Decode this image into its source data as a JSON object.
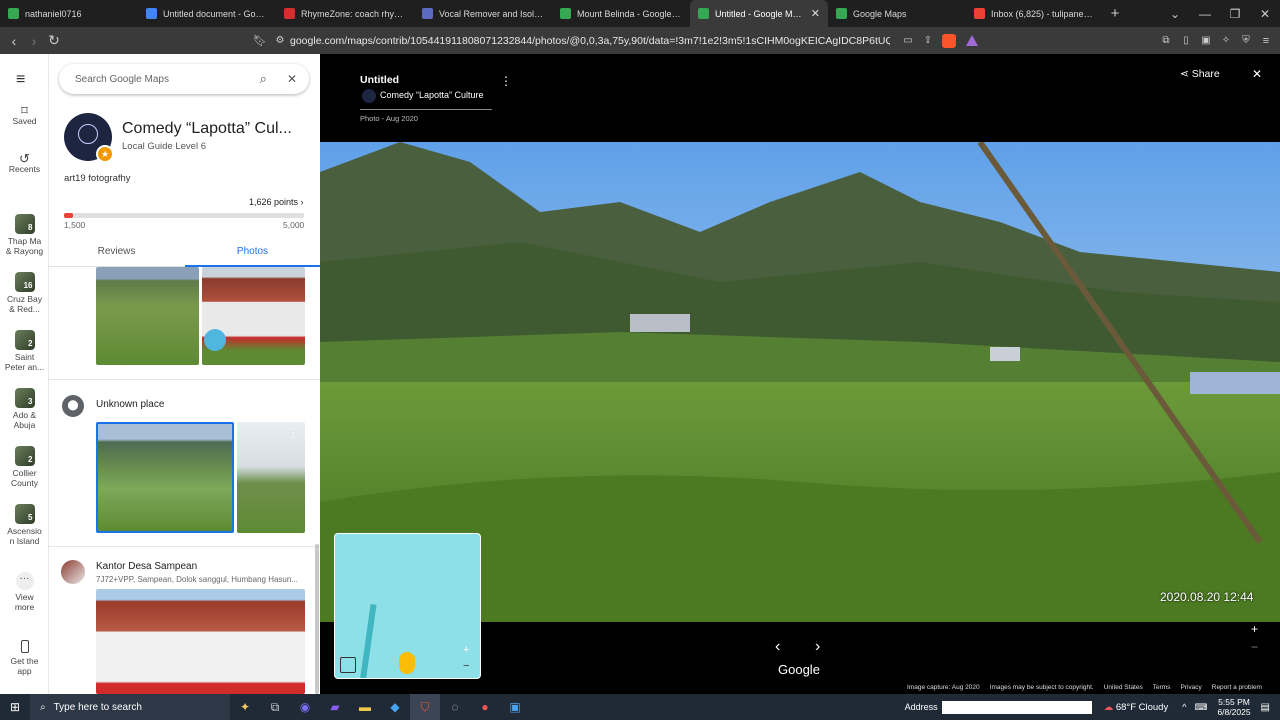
{
  "browser": {
    "tabs": [
      {
        "title": "nathaniel0716",
        "color": "#34a853",
        "active": false
      },
      {
        "title": "Untitled document - Google D",
        "color": "#4285f4",
        "active": false
      },
      {
        "title": "RhymeZone: coach rhymes",
        "color": "#d32f2f",
        "active": false
      },
      {
        "title": "Vocal Remover and Isolation |",
        "color": "#5c6bc0",
        "active": false
      },
      {
        "title": "Mount Belinda - Google Maps",
        "color": "#34a853",
        "active": false
      },
      {
        "title": "Untitled - Google Maps",
        "color": "#34a853",
        "active": true
      },
      {
        "title": "Google Maps",
        "color": "#34a853",
        "active": false
      },
      {
        "title": "Inbox (6,825) - tulipanedean@",
        "color": "#ea4335",
        "active": false
      }
    ],
    "url": "google.com/maps/contrib/105441911808071232844/photos/@0,0,3a,75y,90t/data=!3m7!1e2!3m5!1sCIHM0ogKEICAgIDC8P6tUQ!2e10!6shttps:..."
  },
  "rail": {
    "saved": "Saved",
    "recents": "Recents",
    "items": [
      {
        "count": "8",
        "label": "Thap Ma\n& Rayong"
      },
      {
        "count": "16",
        "label": "Cruz Bay\n& Red..."
      },
      {
        "count": "2",
        "label": "Saint\nPeter an..."
      },
      {
        "count": "3",
        "label": "Ado &\nAbuja"
      },
      {
        "count": "2",
        "label": "Collier\nCounty"
      },
      {
        "count": "5",
        "label": "Ascensio\nn Island"
      }
    ],
    "view_more": "View\nmore",
    "get_app": "Get the\napp"
  },
  "panel": {
    "search_placeholder": "Search Google Maps",
    "profile_name": "Comedy “Lapotta” Cul...",
    "profile_level": "Local Guide Level 6",
    "profile_bio": "art19 fotografhy",
    "points": "1,626 points",
    "progress": {
      "min": "1,500",
      "max": "5,000",
      "fraction": 0.036
    },
    "tabs": [
      {
        "label": "Reviews",
        "active": false
      },
      {
        "label": "Photos",
        "active": true
      }
    ],
    "unknown_place": "Unknown place",
    "kantor_title": "Kantor Desa Sampean",
    "kantor_address": "7J72+VPP, Sampean, Dolok sanggul, Humbang Hasun..."
  },
  "viewer": {
    "title": "Untitled",
    "author": "Comedy “Lapotta” Culture",
    "photo_date": "Photo - Aug 2020",
    "share_label": "Share",
    "timestamp": "2020.08.20 12:44",
    "google_label": "Google",
    "footer": {
      "capture": "Image capture: Aug 2020",
      "copyright": "Images may be subject to copyright.",
      "region": "United States",
      "terms": "Terms",
      "privacy": "Privacy",
      "report": "Report a problem"
    }
  },
  "taskbar": {
    "search_placeholder": "Type here to search",
    "address_label": "Address",
    "weather": "68°F  Cloudy",
    "time": "5:55 PM",
    "date": "6/8/2025"
  }
}
